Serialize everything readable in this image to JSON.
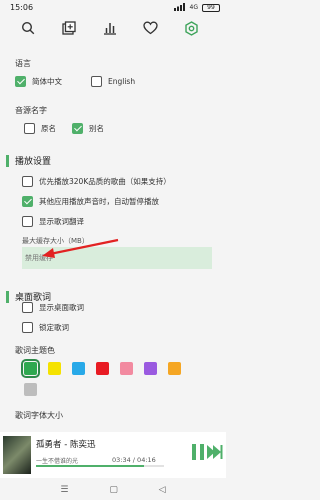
{
  "status": {
    "time": "15:06",
    "network": "4G",
    "battery": "99"
  },
  "toolbar": {
    "icons": [
      "search-icon",
      "add-square-icon",
      "chart-icon",
      "heart-icon",
      "settings-icon"
    ]
  },
  "language": {
    "heading": "语言",
    "options": [
      {
        "label": "简体中文",
        "checked": true
      },
      {
        "label": "English",
        "checked": false
      }
    ]
  },
  "source_name": {
    "heading": "音源名字",
    "options": [
      {
        "label": "原名",
        "checked": false
      },
      {
        "label": "别名",
        "checked": true
      }
    ]
  },
  "playback": {
    "heading": "播放设置",
    "options": [
      {
        "label": "优先播放320K品质的歌曲（如果支持）",
        "checked": false
      },
      {
        "label": "其他应用播放声音时，自动暂停播放",
        "checked": true
      },
      {
        "label": "显示歌词翻译",
        "checked": false
      }
    ],
    "cache": {
      "label": "最大缓存大小（MB）",
      "placeholder": "禁用缓存"
    }
  },
  "desktop_lyric": {
    "heading": "桌面歌词",
    "options": [
      {
        "label": "显示桌面歌词",
        "checked": false
      },
      {
        "label": "锁定歌词",
        "checked": false
      }
    ],
    "theme_heading": "歌词主题色",
    "colors": [
      "#2ea84f",
      "#f5e200",
      "#28a9e8",
      "#e81b23",
      "#f28aa0",
      "#9a5ae0",
      "#f5a623",
      "#bdbdbd"
    ],
    "selected_color": 0,
    "font_size_heading": "歌词字体大小"
  },
  "player": {
    "song": "孤勇者 - 陈奕迅",
    "lyric": "一生不借谁的光",
    "time": "03:34 / 04:16",
    "progress": 0.84
  }
}
